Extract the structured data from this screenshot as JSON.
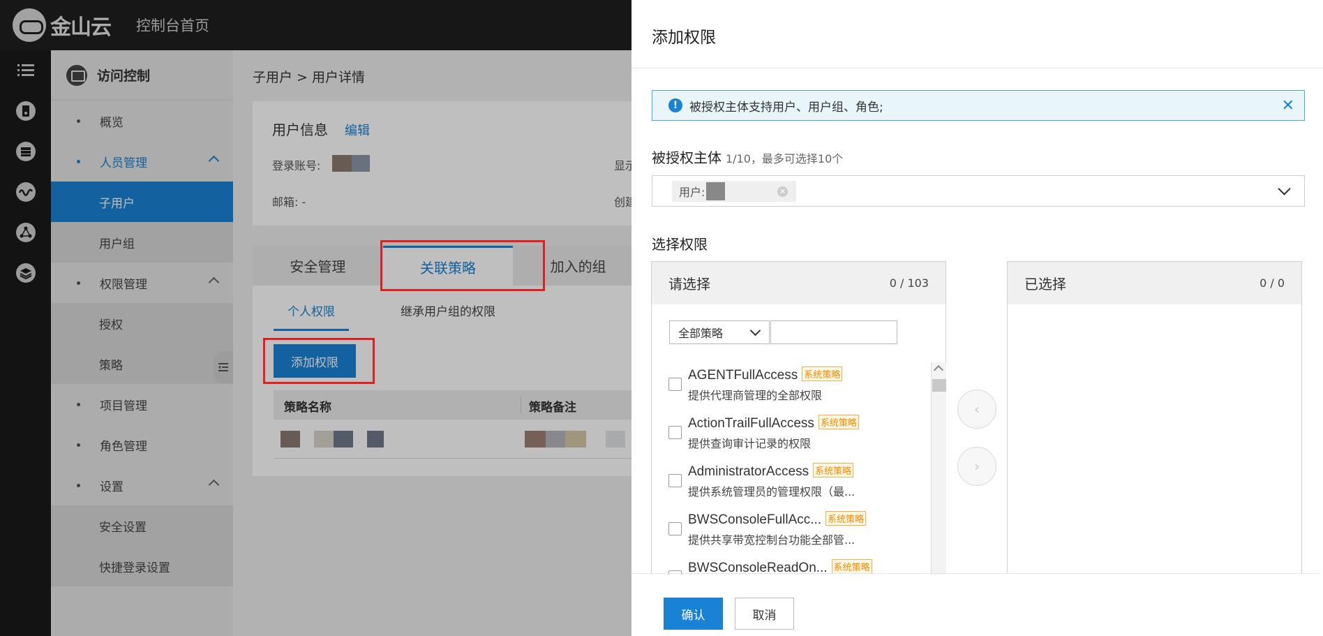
{
  "topbar": {
    "logo_text": "金山云",
    "console_home": "控制台首页"
  },
  "rail": {
    "icons": [
      "menu-icon",
      "server-icon",
      "database-icon",
      "network-icon",
      "topology-icon",
      "layers-icon"
    ]
  },
  "sidebar": {
    "header": "访问控制",
    "items": {
      "overview": "概览",
      "people": "人员管理",
      "subuser": "子用户",
      "usergroup": "用户组",
      "perm": "权限管理",
      "grant": "授权",
      "policy": "策略",
      "project": "项目管理",
      "role": "角色管理",
      "settings": "设置",
      "security": "安全设置",
      "quicklogin": "快捷登录设置"
    }
  },
  "main": {
    "breadcrumb": "子用户 > 用户详情",
    "info_title": "用户信息",
    "info_edit": "编辑",
    "login_label": "登录账号:",
    "display_label": "显示",
    "email_label": "邮箱: -",
    "created_label": "创建",
    "tabs": [
      "安全管理",
      "关联策略",
      "加入的组"
    ],
    "subtabs": [
      "个人权限",
      "继承用户组的权限"
    ],
    "add_button": "添加权限",
    "table_headers": [
      "策略名称",
      "策略备注"
    ]
  },
  "drawer": {
    "title": "添加权限",
    "alert": "被授权主体支持用户、用户组、角色;",
    "principal_label": "被授权主体",
    "principal_hint": "1/10，最多可选择10个",
    "chip_label": "用户:",
    "select_perm_label": "选择权限",
    "left_panel": {
      "title": "请选择",
      "count": "0 / 103"
    },
    "right_panel": {
      "title": "已选择",
      "count": "0 / 0"
    },
    "filter_dropdown": "全部策略",
    "filter_placeholder": "",
    "tag_label": "系统策略",
    "policies": [
      {
        "name": "AGENTFullAccess",
        "desc": "提供代理商管理的全部权限"
      },
      {
        "name": "ActionTrailFullAccess",
        "desc": "提供查询审计记录的权限"
      },
      {
        "name": "AdministratorAccess",
        "desc": "提供系统管理员的管理权限（最..."
      },
      {
        "name": "BWSConsoleFullAcc...",
        "desc": "提供共享带宽控制台功能全部管..."
      },
      {
        "name": "BWSConsoleReadOn...",
        "desc": ""
      }
    ],
    "move_left": "‹",
    "move_right": "›",
    "ok": "确认",
    "cancel": "取消"
  }
}
